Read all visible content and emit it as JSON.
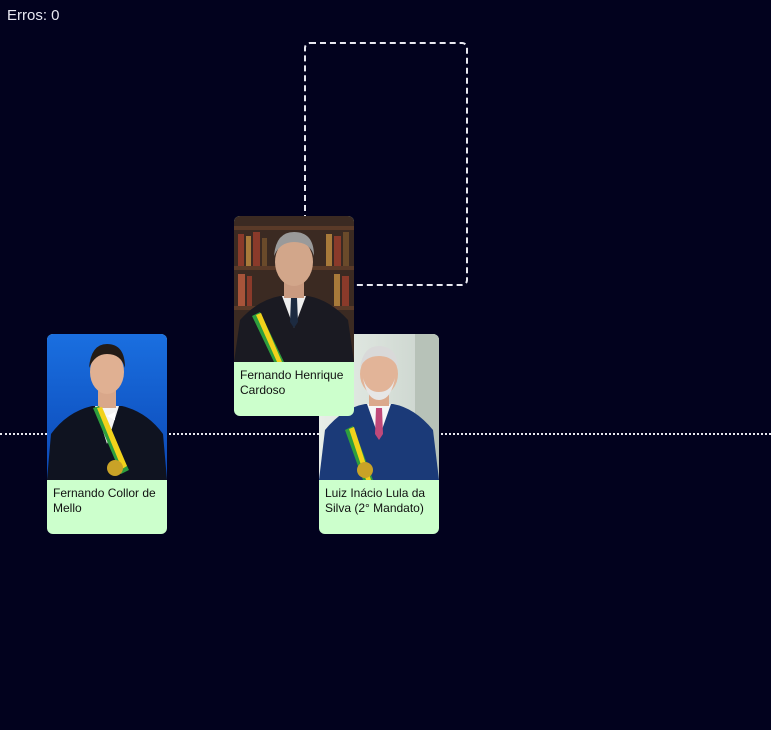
{
  "errors_label": "Erros: 0",
  "cards": [
    {
      "name": "Fernando Collor de Mello",
      "photo": "portrait-collor-icon"
    },
    {
      "name": "Fernando Henrique Cardoso",
      "photo": "portrait-fhc-icon"
    },
    {
      "name": "Luiz Inácio Lula da Silva (2° Mandato)",
      "photo": "portrait-lula-icon"
    }
  ],
  "colors": {
    "background": "#02021e",
    "card": "#ccffcc",
    "line": "#e8e8f0",
    "sash_green": "#2e9e3e",
    "sash_yellow": "#f2d21b"
  }
}
